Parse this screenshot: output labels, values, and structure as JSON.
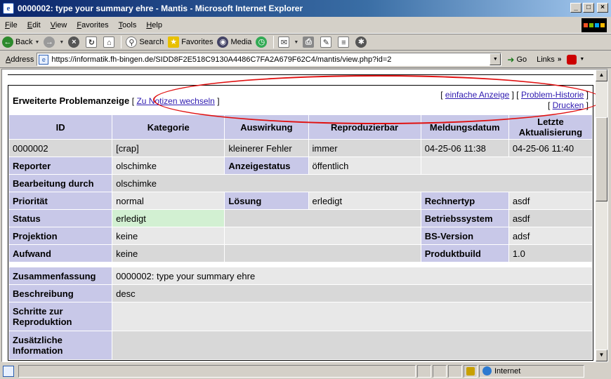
{
  "window": {
    "title": "0000002: type your summary ehre - Mantis - Microsoft Internet Explorer",
    "icon": "ie-icon",
    "controls": {
      "minimize": "_",
      "maximize": "□",
      "close": "×"
    }
  },
  "menu": [
    "File",
    "Edit",
    "View",
    "Favorites",
    "Tools",
    "Help"
  ],
  "toolbar": {
    "back": "Back",
    "search": "Search",
    "favorites": "Favorites",
    "media": "Media"
  },
  "address": {
    "label": "Address",
    "url": "https://informatik.fh-bingen.de/SIDD8F2E518C9130A4486C7FA2A679F62C4/mantis/view.php?id=2",
    "go": "Go",
    "links": "Links"
  },
  "bug": {
    "title": "Erweiterte Problemanzeige",
    "notes_link": "Zu Notizen wechseln",
    "simple_link": "einfache Anzeige",
    "history_link": "Problem-Historie",
    "print_link": "Drucken",
    "columns": [
      "ID",
      "Kategorie",
      "Auswirkung",
      "Reproduzierbar",
      "Meldungsdatum",
      "Letzte Aktualisierung"
    ],
    "values": [
      "0000002",
      "[crap]",
      "kleinerer Fehler",
      "immer",
      "04-25-06 11:38",
      "04-25-06 11:40"
    ],
    "reporter_label": "Reporter",
    "reporter": "olschimke",
    "view_status_label": "Anzeigestatus",
    "view_status": "öffentlich",
    "handler_label": "Bearbeitung durch",
    "handler": "olschimke",
    "priority_label": "Priorität",
    "priority": "normal",
    "resolution_label": "Lösung",
    "resolution": "erledigt",
    "platform_label": "Rechnertyp",
    "platform": "asdf",
    "status_label": "Status",
    "status": "erledigt",
    "os_label": "Betriebssystem",
    "os": "asdf",
    "projection_label": "Projektion",
    "projection": "keine",
    "os_build_label": "BS-Version",
    "os_build": "adsf",
    "eta_label": "Aufwand",
    "eta": "keine",
    "build_label": "Produktbuild",
    "build": "1.0",
    "summary_label": "Zusammenfassung",
    "summary": "0000002: type your summary ehre",
    "description_label": "Beschreibung",
    "description": "desc",
    "steps_label": "Schritte zur Reproduktion",
    "steps": "",
    "additional_label": "Zusätzliche Information",
    "additional": ""
  },
  "status_bar": {
    "zone": "Internet"
  },
  "colors": {
    "label_bg": "#c8c8e8",
    "row_light": "#e8e8e8",
    "row_dark": "#d8d8d8",
    "status_resolved": "#d2f0d2",
    "annotation": "#e01010"
  }
}
